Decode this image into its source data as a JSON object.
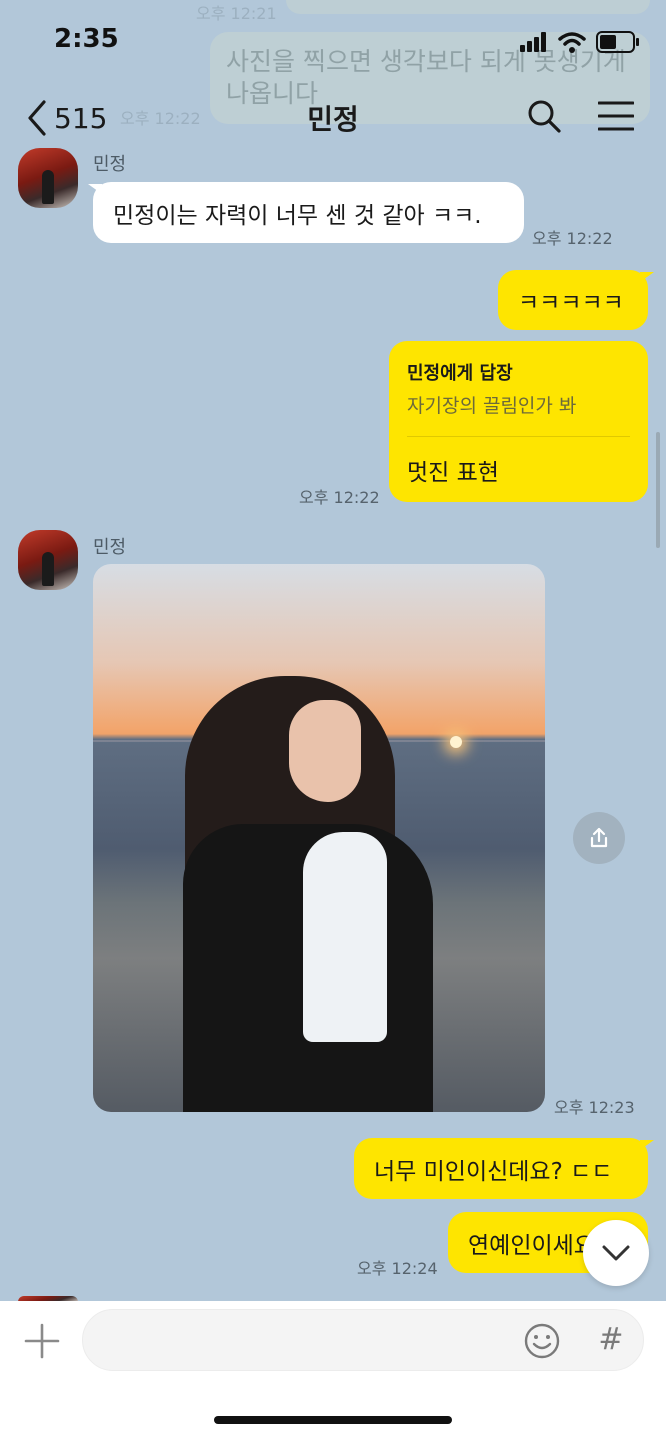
{
  "status_bar": {
    "time": "2:35"
  },
  "ghost": {
    "top_time": "오후 12:21",
    "message": "사진을 찍으면 생각보다 되게 못생기게 나옵니다",
    "time": "오후 12:22"
  },
  "header": {
    "back_count": "515",
    "title": "민정"
  },
  "messages": [
    {
      "sender": "민정",
      "text": "민정이는 자력이 너무 센 것 같아 ㅋㅋ.",
      "time": "오후 12:22"
    },
    {
      "text": "ㅋㅋㅋㅋㅋ"
    },
    {
      "reply_to": "민정에게 답장",
      "quote": "자기장의 끌림인가 봐",
      "text": "멋진 표현",
      "time": "오후 12:22"
    },
    {
      "sender": "민정",
      "type": "photo",
      "time": "오후 12:23"
    },
    {
      "text": "너무 미인이신데요? ㄷㄷ"
    },
    {
      "text": "연예인이세요??",
      "time": "오후 12:24"
    }
  ],
  "input": {
    "placeholder": "",
    "hash": "#"
  },
  "colors": {
    "background": "#b2c7d9",
    "mine": "#fee500",
    "theirs": "#ffffff"
  },
  "icons": [
    "back-chevron-icon",
    "search-icon",
    "menu-icon",
    "share-icon",
    "chevron-down-icon",
    "plus-icon",
    "emoji-icon",
    "hashtag-icon"
  ]
}
